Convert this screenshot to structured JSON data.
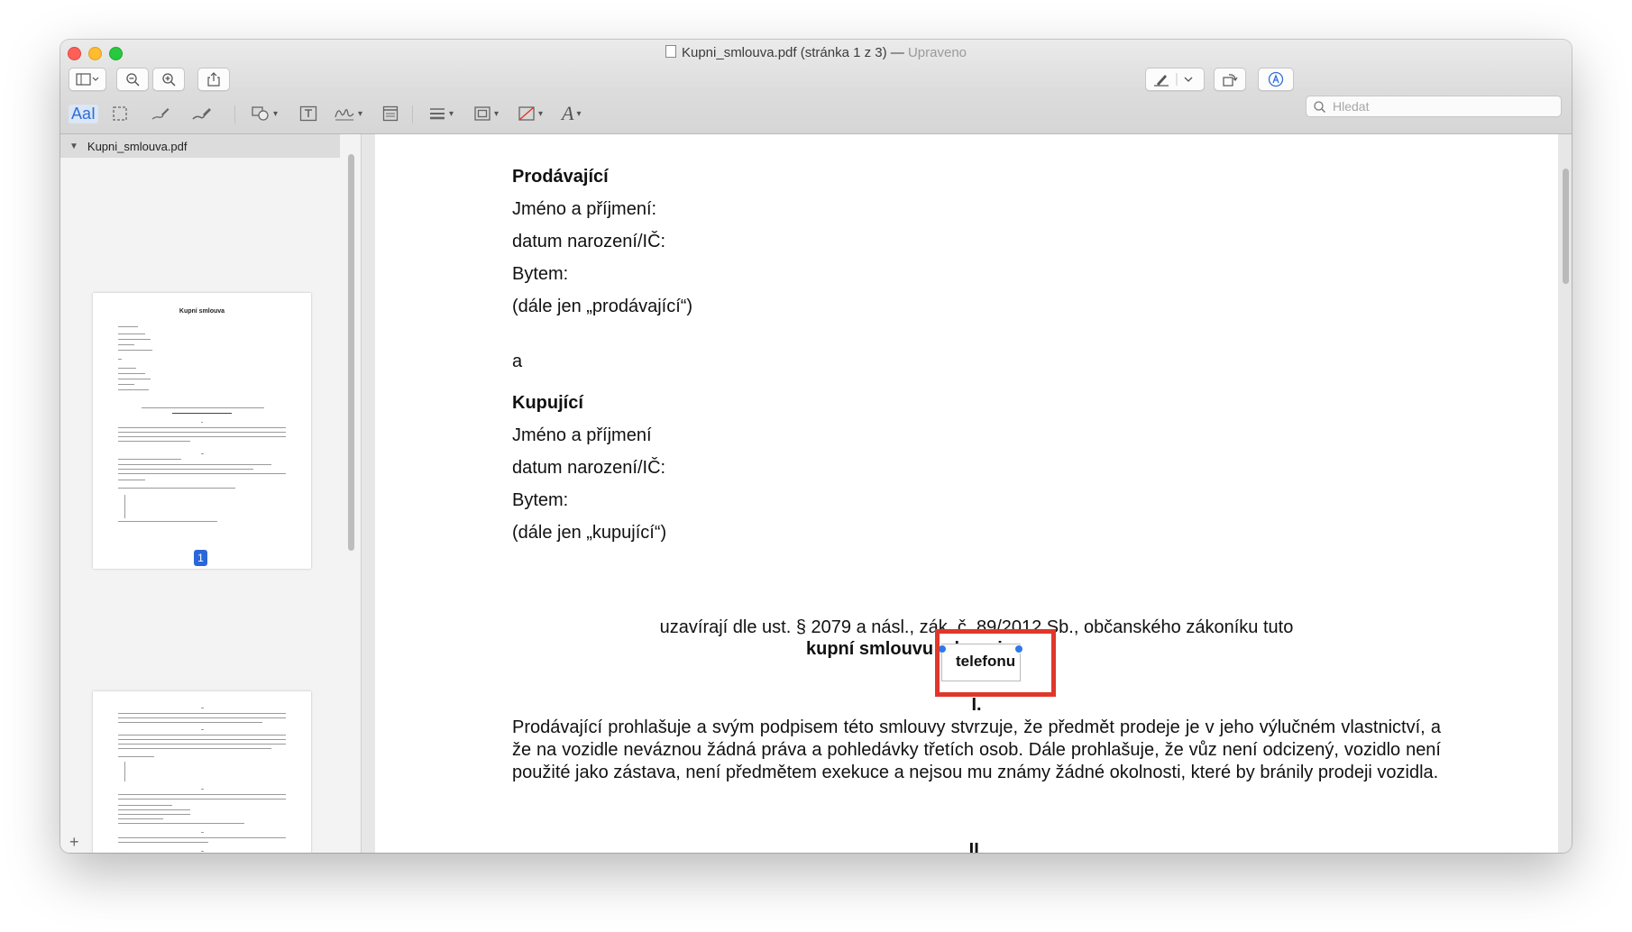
{
  "window": {
    "filename": "Kupni_smlouva.pdf",
    "page_info": "(stránka 1 z 3)",
    "separator": " — ",
    "status": "Upraveno"
  },
  "toolbar": {
    "search_placeholder": "Hledat",
    "text_select_label": "AaI"
  },
  "sidebar": {
    "doc_name": "Kupni_smlouva.pdf",
    "page_badge": "1",
    "thumb1_title": "Kupní smlouva"
  },
  "document": {
    "seller_heading": "Prodávající",
    "seller_name": "Jméno a příjmení:",
    "seller_birth": "datum narození/IČ:",
    "seller_address": "Bytem:",
    "seller_ref": "(dále jen „prodávající“)",
    "and": "a",
    "buyer_heading": "Kupující",
    "buyer_name": "Jméno a příjmení",
    "buyer_birth": "datum narození/IČ:",
    "buyer_address": "Bytem:",
    "buyer_ref": "(dále jen „kupující“)",
    "agreement_line": "uzavírají dle ust. § 2079 a násl., zák. č. 89/2012 Sb., občanského zákoníku tuto",
    "contract_title": "kupní smlouvu o koupi",
    "annotation_text": "telefonu",
    "section_1": "I.",
    "section_1_text": "Prodávající prohlašuje a svým podpisem této smlouvy stvrzuje, že předmět prodeje je v jeho výlučném vlastnictví, a že na vozidle neváznou žádná práva a pohledávky třetích osob. Dále prohlašuje, že vůz není odcizený, vozidlo není použité jako zástava, není předmětem exekuce a nejsou mu známy žádné okolnosti, které by bránily prodeji vozidla.",
    "section_2": "II."
  },
  "colors": {
    "highlight_box": "#e0372b",
    "handle": "#2f78e8",
    "page_badge": "#2b67d9"
  }
}
